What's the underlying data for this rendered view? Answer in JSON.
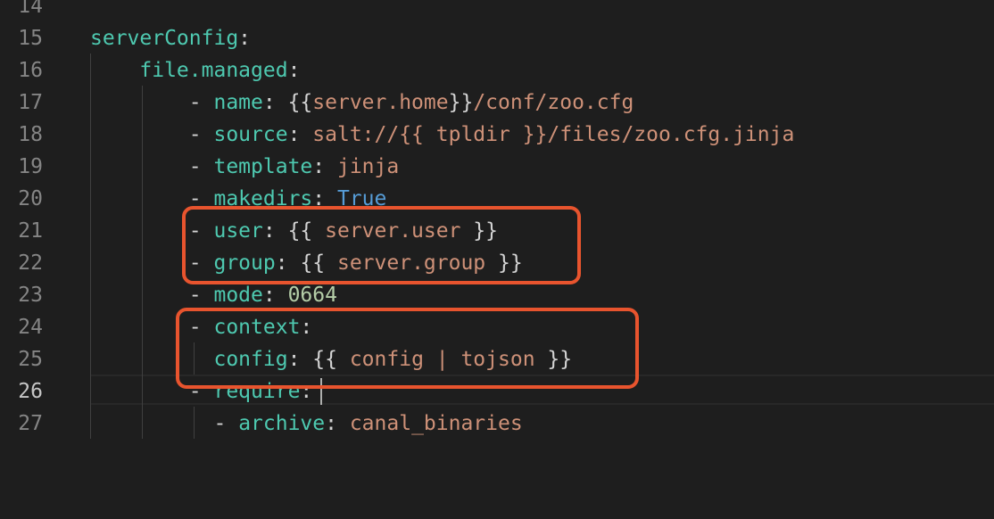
{
  "editor": {
    "lines": [
      {
        "number": "14",
        "active": false,
        "indent": "",
        "tokens": []
      },
      {
        "number": "15",
        "active": false,
        "indent": "",
        "tokens": [
          {
            "t": "serverConfig",
            "c": "key"
          },
          {
            "t": ":",
            "c": "punct"
          }
        ]
      },
      {
        "number": "16",
        "active": false,
        "indent": "    ",
        "tokens": [
          {
            "t": "file.managed",
            "c": "key"
          },
          {
            "t": ":",
            "c": "punct"
          }
        ]
      },
      {
        "number": "17",
        "active": false,
        "indent": "        ",
        "tokens": [
          {
            "t": "- ",
            "c": "punct"
          },
          {
            "t": "name",
            "c": "key"
          },
          {
            "t": ": ",
            "c": "punct"
          },
          {
            "t": "{{",
            "c": "punct"
          },
          {
            "t": "server.home",
            "c": "str"
          },
          {
            "t": "}}",
            "c": "punct"
          },
          {
            "t": "/conf/zoo.cfg",
            "c": "str"
          }
        ]
      },
      {
        "number": "18",
        "active": false,
        "indent": "        ",
        "tokens": [
          {
            "t": "- ",
            "c": "punct"
          },
          {
            "t": "source",
            "c": "key"
          },
          {
            "t": ": ",
            "c": "punct"
          },
          {
            "t": "salt://{{ tpldir }}/files/zoo.cfg.jinja",
            "c": "str"
          }
        ]
      },
      {
        "number": "19",
        "active": false,
        "indent": "        ",
        "tokens": [
          {
            "t": "- ",
            "c": "punct"
          },
          {
            "t": "template",
            "c": "key"
          },
          {
            "t": ": ",
            "c": "punct"
          },
          {
            "t": "jinja",
            "c": "str"
          }
        ]
      },
      {
        "number": "20",
        "active": false,
        "indent": "        ",
        "tokens": [
          {
            "t": "- ",
            "c": "punct"
          },
          {
            "t": "makedirs",
            "c": "key"
          },
          {
            "t": ": ",
            "c": "punct"
          },
          {
            "t": "True",
            "c": "bool"
          }
        ]
      },
      {
        "number": "21",
        "active": false,
        "indent": "        ",
        "tokens": [
          {
            "t": "- ",
            "c": "punct"
          },
          {
            "t": "user",
            "c": "key"
          },
          {
            "t": ": ",
            "c": "punct"
          },
          {
            "t": "{{ ",
            "c": "punct"
          },
          {
            "t": "server.user",
            "c": "str"
          },
          {
            "t": " }}",
            "c": "punct"
          }
        ]
      },
      {
        "number": "22",
        "active": false,
        "indent": "        ",
        "tokens": [
          {
            "t": "- ",
            "c": "punct"
          },
          {
            "t": "group",
            "c": "key"
          },
          {
            "t": ": ",
            "c": "punct"
          },
          {
            "t": "{{ ",
            "c": "punct"
          },
          {
            "t": "server.group",
            "c": "str"
          },
          {
            "t": " }}",
            "c": "punct"
          }
        ]
      },
      {
        "number": "23",
        "active": false,
        "indent": "        ",
        "tokens": [
          {
            "t": "- ",
            "c": "punct"
          },
          {
            "t": "mode",
            "c": "key"
          },
          {
            "t": ": ",
            "c": "punct"
          },
          {
            "t": "0664",
            "c": "num"
          }
        ]
      },
      {
        "number": "24",
        "active": false,
        "indent": "        ",
        "tokens": [
          {
            "t": "- ",
            "c": "punct"
          },
          {
            "t": "context",
            "c": "key"
          },
          {
            "t": ":",
            "c": "punct"
          }
        ]
      },
      {
        "number": "25",
        "active": false,
        "indent": "          ",
        "tokens": [
          {
            "t": "config",
            "c": "key"
          },
          {
            "t": ": ",
            "c": "punct"
          },
          {
            "t": "{{ ",
            "c": "punct"
          },
          {
            "t": "config | tojson",
            "c": "str"
          },
          {
            "t": " }}",
            "c": "punct"
          }
        ]
      },
      {
        "number": "26",
        "active": true,
        "indent": "        ",
        "tokens": [
          {
            "t": "- ",
            "c": "punct"
          },
          {
            "t": "require",
            "c": "key"
          },
          {
            "t": ":",
            "c": "punct"
          }
        ]
      },
      {
        "number": "27",
        "active": false,
        "indent": "          ",
        "tokens": [
          {
            "t": "- ",
            "c": "punct"
          },
          {
            "t": "archive",
            "c": "key"
          },
          {
            "t": ": ",
            "c": "punct"
          },
          {
            "t": "canal_binaries",
            "c": "str"
          }
        ]
      }
    ],
    "highlight_color": "#e8542e"
  }
}
